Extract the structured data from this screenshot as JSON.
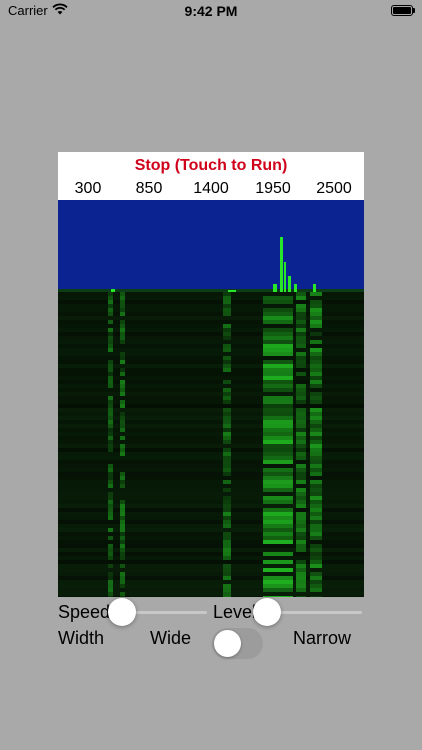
{
  "status_bar": {
    "carrier": "Carrier",
    "time": "9:42 PM"
  },
  "display": {
    "run_status": "Stop (Touch to Run)",
    "frequency_labels": [
      "300",
      "850",
      "1400",
      "1950",
      "2500"
    ]
  },
  "controls": {
    "speed": {
      "label": "Speed",
      "value": 0.05
    },
    "level": {
      "label": "Level",
      "value": 0.05
    },
    "width": {
      "label": "Width",
      "left_label": "Wide",
      "right_label": "Narrow",
      "on": false
    }
  },
  "colors": {
    "background": "#a9a9a9",
    "spectrum": "#0a2390",
    "signal": "#28e628",
    "run_status": "#d0021b",
    "slider_accent": "#3478f6"
  },
  "icons": [
    "wifi-icon",
    "battery-icon"
  ]
}
